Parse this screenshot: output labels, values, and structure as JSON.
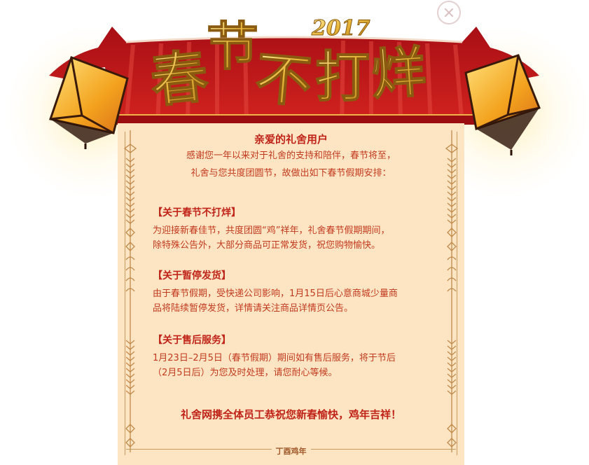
{
  "header": {
    "title_chars": [
      "春",
      "节",
      "不",
      "打",
      "烊"
    ],
    "year": "2017"
  },
  "close_button": {
    "icon": "close-icon"
  },
  "letter": {
    "greeting": "亲爱的礼舍用户",
    "intro_lines": [
      "感谢您一年以来对于礼舍的支持和陪伴，春节将至，",
      "礼舍与您共度团圆节，故做出如下春节假期安排："
    ],
    "sections": [
      {
        "title": "【关于春节不打烊】",
        "lines": [
          "为迎接新春佳节，共度团圆“鸡”祥年，礼舍春节假期期间，",
          "除特殊公告外，大部分商品可正常发货，祝您购物愉快。"
        ]
      },
      {
        "title": "【关于暂停发货】",
        "lines": [
          "由于春节假期，受快递公司影响，1月15日后心意商城少量商",
          "品将陆续暂停发货，详情请关注商品详情页公告。"
        ]
      },
      {
        "title": "【关于售后服务】",
        "lines": [
          "1月23日–2月5日（春节假期）期间如有售后服务，将于节后",
          "（2月5日后）为您及时处理，请您耐心等候。"
        ]
      }
    ],
    "closing": "礼舍网携全体员工恭祝您新春愉快，鸡年吉祥！",
    "year_mark": "丁酉鸡年"
  },
  "colors": {
    "roof_red": "#c8171d",
    "paper": "#fde5c4",
    "text_red": "#c02418",
    "gold": "#e8b73a"
  }
}
